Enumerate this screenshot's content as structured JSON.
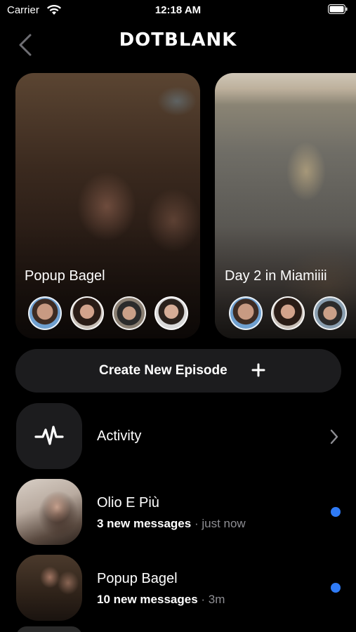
{
  "status_bar": {
    "carrier": "Carrier",
    "time": "12:18 AM",
    "wifi_icon": "wifi-icon",
    "battery_icon": "battery-icon"
  },
  "nav": {
    "title": "DOTBLANK",
    "back_icon": "chevron-left-icon"
  },
  "episodes": [
    {
      "title": "Popup Bagel",
      "avatars": [
        "avatar-1",
        "avatar-2",
        "avatar-3",
        "avatar-4"
      ]
    },
    {
      "title": "Day 2 in Miamiiii",
      "avatars": [
        "avatar-1",
        "avatar-2",
        "avatar-3"
      ]
    }
  ],
  "create_button": {
    "label": "Create New Episode",
    "icon": "plus-icon"
  },
  "activity": {
    "title": "Activity",
    "icon": "pulse-icon",
    "chevron": "chevron-right-icon"
  },
  "conversations": [
    {
      "title": "Olio E Più",
      "count": "3 new messages",
      "separator": "·",
      "time": "just now",
      "unread": true
    },
    {
      "title": "Popup Bagel",
      "count": "10 new messages",
      "separator": "·",
      "time": "3m",
      "unread": true
    }
  ],
  "colors": {
    "background": "#000000",
    "surface": "#1c1c1e",
    "accent_unread": "#2f7bf6",
    "secondary_text": "#8e8e93"
  }
}
